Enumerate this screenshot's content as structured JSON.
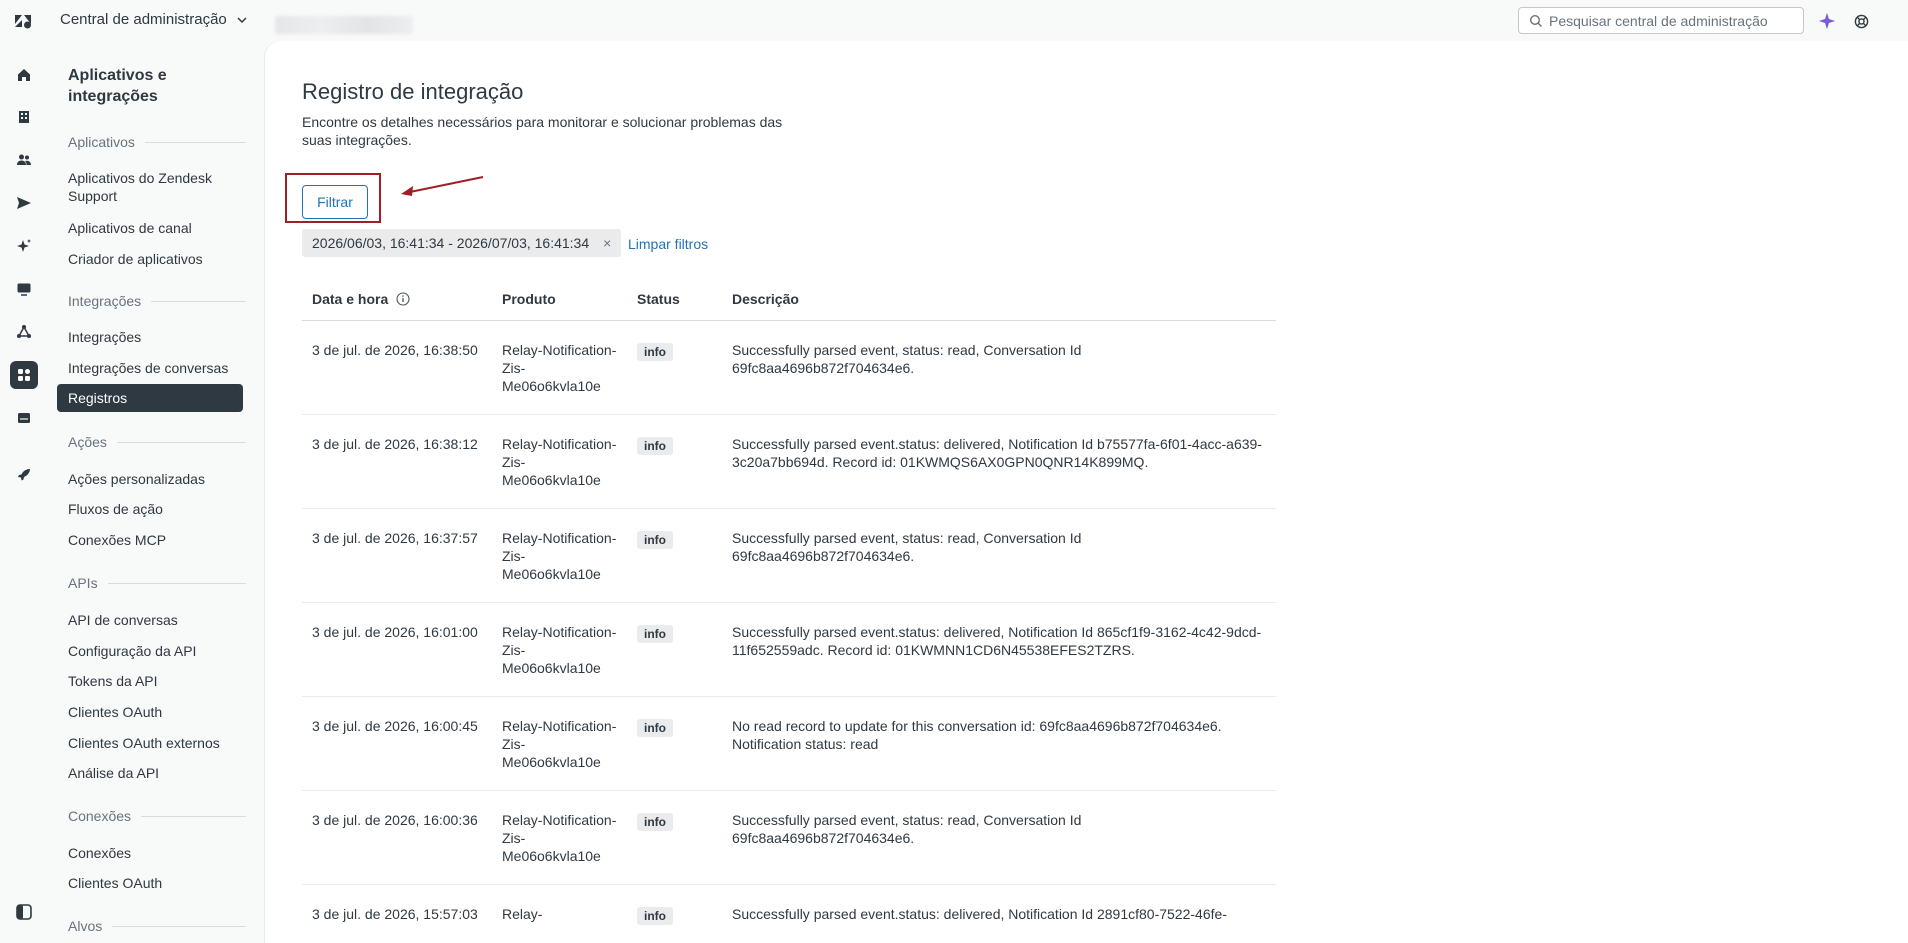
{
  "header": {
    "product_name": "Central de administração",
    "search_placeholder": "Pesquisar central de administração"
  },
  "rail": {
    "items": [
      "home-icon",
      "building-icon",
      "people-icon",
      "send-icon",
      "sparkle-icon",
      "monitor-icon",
      "triangle-nodes-icon",
      "apps-icon",
      "server-icon",
      "rocket-icon"
    ],
    "active": "apps-icon"
  },
  "subnav": {
    "title": "Aplicativos e integrações",
    "sections": [
      {
        "heading": "Aplicativos",
        "links": [
          "Aplicativos do Zendesk Support",
          "Aplicativos de canal",
          "Criador de aplicativos"
        ]
      },
      {
        "heading": "Integrações",
        "links": [
          "Integrações",
          "Integrações de conversas",
          "Registros"
        ]
      },
      {
        "heading": "Ações",
        "links": [
          "Ações personalizadas",
          "Fluxos de ação",
          "Conexões MCP"
        ]
      },
      {
        "heading": "APIs",
        "links": [
          "API de conversas",
          "Configuração da API",
          "Tokens da API",
          "Clientes OAuth",
          "Clientes OAuth externos",
          "Análise da API"
        ]
      },
      {
        "heading": "Conexões",
        "links": [
          "Conexões",
          "Clientes OAuth"
        ]
      },
      {
        "heading": "Alvos",
        "links": []
      }
    ],
    "active_link": "Registros"
  },
  "main": {
    "title": "Registro de integração",
    "description": "Encontre os detalhes necessários para monitorar e solucionar problemas das suas integrações.",
    "filter_button": "Filtrar",
    "chip_label": "2026/06/03, 16:41:34 - 2026/07/03, 16:41:34",
    "chip_close": "×",
    "clear_filters": "Limpar filtros",
    "columns": [
      "Data e hora",
      "Produto",
      "Status",
      "Descrição"
    ],
    "rows": [
      {
        "date": "3 de jul. de 2026, 16:38:50",
        "product": "Relay-Notification-Zis-Me06o6kvla10e",
        "status": "info",
        "description": "Successfully parsed event, status: read, Conversation Id 69fc8aa4696b872f704634e6."
      },
      {
        "date": "3 de jul. de 2026, 16:38:12",
        "product": "Relay-Notification-Zis-Me06o6kvla10e",
        "status": "info",
        "description": "Successfully parsed event.status: delivered, Notification Id b75577fa-6f01-4acc-a639-3c20a7bb694d. Record id: 01KWMQS6AX0GPN0QNR14K899MQ."
      },
      {
        "date": "3 de jul. de 2026, 16:37:57",
        "product": "Relay-Notification-Zis-Me06o6kvla10e",
        "status": "info",
        "description": "Successfully parsed event, status: read, Conversation Id 69fc8aa4696b872f704634e6."
      },
      {
        "date": "3 de jul. de 2026, 16:01:00",
        "product": "Relay-Notification-Zis-Me06o6kvla10e",
        "status": "info",
        "description": "Successfully parsed event.status: delivered, Notification Id 865cf1f9-3162-4c42-9dcd-11f652559adc. Record id: 01KWMNN1CD6N45538EFES2TZRS."
      },
      {
        "date": "3 de jul. de 2026, 16:00:45",
        "product": "Relay-Notification-Zis-Me06o6kvla10e",
        "status": "info",
        "description": "No read record to update for this conversation id: 69fc8aa4696b872f704634e6. Notification status: read"
      },
      {
        "date": "3 de jul. de 2026, 16:00:36",
        "product": "Relay-Notification-Zis-Me06o6kvla10e",
        "status": "info",
        "description": "Successfully parsed event, status: read, Conversation Id 69fc8aa4696b872f704634e6."
      },
      {
        "date": "3 de jul. de 2026, 15:57:03",
        "product": "Relay-",
        "status": "info",
        "description": "Successfully parsed event.status: delivered, Notification Id 2891cf80-7522-46fe-"
      }
    ]
  }
}
